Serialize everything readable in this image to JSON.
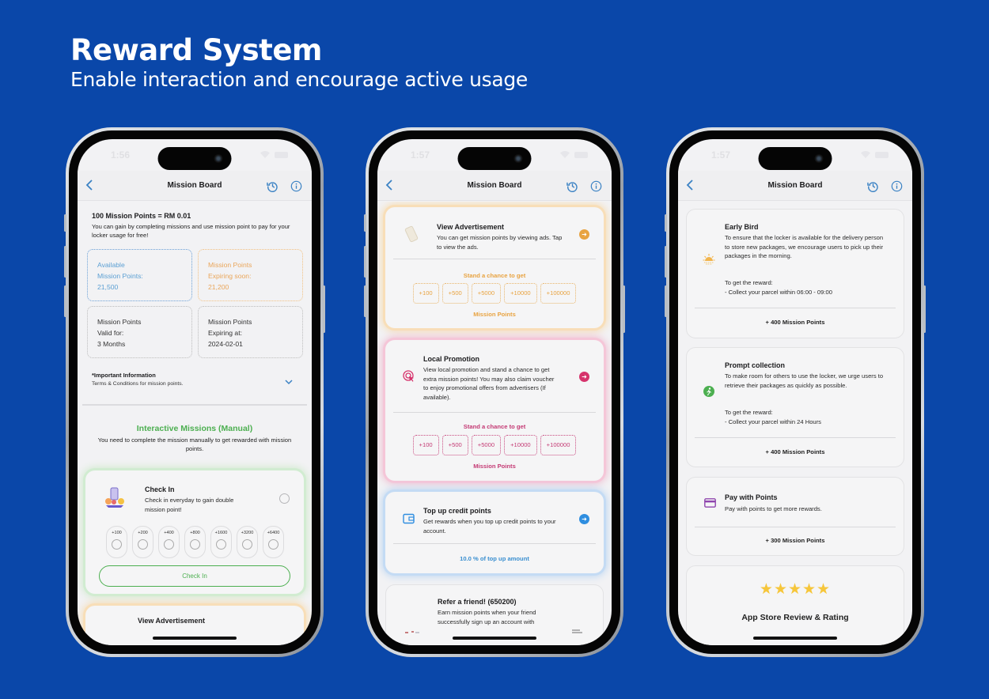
{
  "hero": {
    "title": "Reward System",
    "subtitle": "Enable interaction and encourage active usage"
  },
  "phones": [
    {
      "status_time": "1:56",
      "nav_title": "Mission Board",
      "intro": {
        "title": "100 Mission Points = RM 0.01",
        "text": "You can gain by completing missions and use mission point to pay for your locker usage for free!"
      },
      "stats": [
        {
          "line1": "Available",
          "line2": "Mission Points:",
          "value": "21,500",
          "color": "#5b9fd3"
        },
        {
          "line1": "Mission Points",
          "line2": "Expiring soon:",
          "value": "21,200",
          "color": "#eaa65a"
        },
        {
          "line1": "Mission Points",
          "line2": "Valid for:",
          "value": "3 Months"
        },
        {
          "line1": "Mission Points",
          "line2": "Expiring at:",
          "value": "2024-02-01"
        }
      ],
      "important": {
        "title": "*Important Information",
        "text": "Terms & Conditions for mission points."
      },
      "section": {
        "title": "Interactive Missions (Manual)",
        "text": "You need to complete the mission manually to get rewarded with mission points."
      },
      "checkin": {
        "title": "Check In",
        "desc": "Check in everyday to gain double mission point!",
        "days": [
          "+100",
          "+200",
          "+400",
          "+800",
          "+1600",
          "+3200",
          "+6400"
        ],
        "button": "Check In"
      },
      "next_card_title": "View Advertisement"
    },
    {
      "status_time": "1:57",
      "nav_title": "Mission Board",
      "cards": [
        {
          "title": "View Advertisement",
          "desc": "You can get mission points by viewing ads. Tap to view the ads.",
          "chance": "Stand a chance to get",
          "chips": [
            "+100",
            "+500",
            "+5000",
            "+10000",
            "+100000"
          ],
          "label": "Mission Points",
          "accent": "#e8a341"
        },
        {
          "title": "Local Promotion",
          "desc": "View local promotion and stand a chance to get extra mission points! You may also claim voucher to enjoy promotional offers from advertisers (If available).",
          "chance": "Stand a chance to get",
          "chips": [
            "+100",
            "+500",
            "+5000",
            "+10000",
            "+100000"
          ],
          "label": "Mission Points",
          "accent": "#d6336c"
        },
        {
          "title": "Top up credit points",
          "desc": "Get rewards when you top up credit points to your account.",
          "reward": "10.0 % of top up amount",
          "accent": "#2f8ee0"
        },
        {
          "title": "Refer a friend! (650200)",
          "desc": "Earn mission points when your friend successfully sign up an account with"
        }
      ]
    },
    {
      "status_time": "1:57",
      "nav_title": "Mission Board",
      "cards": [
        {
          "title": "Early Bird",
          "desc": "To ensure that the locker is available for the delivery person to store new packages, we encourage users to pick up their packages in the morning.",
          "req_title": "To get the reward:",
          "req": "- Collect your parcel within  06:00 - 09:00",
          "reward": "+ 400 Mission Points"
        },
        {
          "title": "Prompt collection",
          "desc": "To make room for others to use the locker, we urge users to retrieve their packages as quickly as possible.",
          "req_title": "To get the reward:",
          "req": "- Collect your parcel within 24 Hours",
          "reward": "+ 400 Mission Points"
        },
        {
          "title": "Pay with Points",
          "desc": "Pay with points to get more rewards.",
          "reward": "+ 300 Mission Points"
        },
        {
          "stars": "★★★★★",
          "rating": 5,
          "title": "App Store Review & Rating"
        }
      ]
    }
  ]
}
